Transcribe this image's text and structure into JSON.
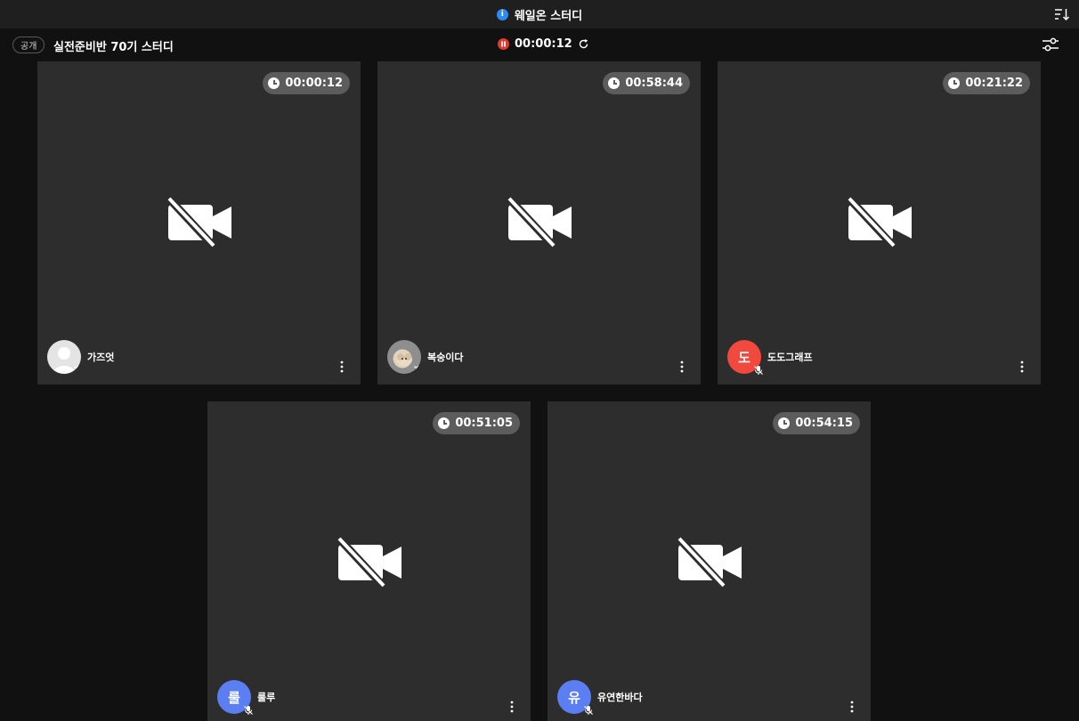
{
  "window": {
    "title": "웨일온 스터디",
    "info_glyph": "i",
    "info_icon": "info-icon",
    "sort_icon": "sort-icon"
  },
  "room": {
    "visibility": "공개",
    "name": "실전준비반 70기 스터디",
    "session_time": "00:00:12",
    "pause_icon": "pause-icon",
    "refresh_icon": "refresh-icon",
    "settings_icon": "settings-sliders-icon"
  },
  "colors": {
    "tile_bg": "#2d2d2d",
    "page_bg": "#111111",
    "accent_blue": "#2d8cf0",
    "record_red": "#e0392e"
  },
  "participants": [
    {
      "name": "가즈엇",
      "timer": "00:00:12",
      "avatar_type": "silhouette",
      "avatar_text": "",
      "avatar_color": "#e4e4e4"
    },
    {
      "name": "복숭이다",
      "timer": "00:58:44",
      "avatar_type": "photo",
      "avatar_text": "",
      "avatar_color": "#8e8e8e"
    },
    {
      "name": "도도그래프",
      "timer": "00:21:22",
      "avatar_type": "initial",
      "avatar_text": "도",
      "avatar_color": "#f2493f"
    },
    {
      "name": "룰루",
      "timer": "00:51:05",
      "avatar_type": "initial",
      "avatar_text": "룰",
      "avatar_color": "#5b7ff2"
    },
    {
      "name": "유연한바다",
      "timer": "00:54:15",
      "avatar_type": "initial",
      "avatar_text": "유",
      "avatar_color": "#5b7ff2"
    }
  ]
}
